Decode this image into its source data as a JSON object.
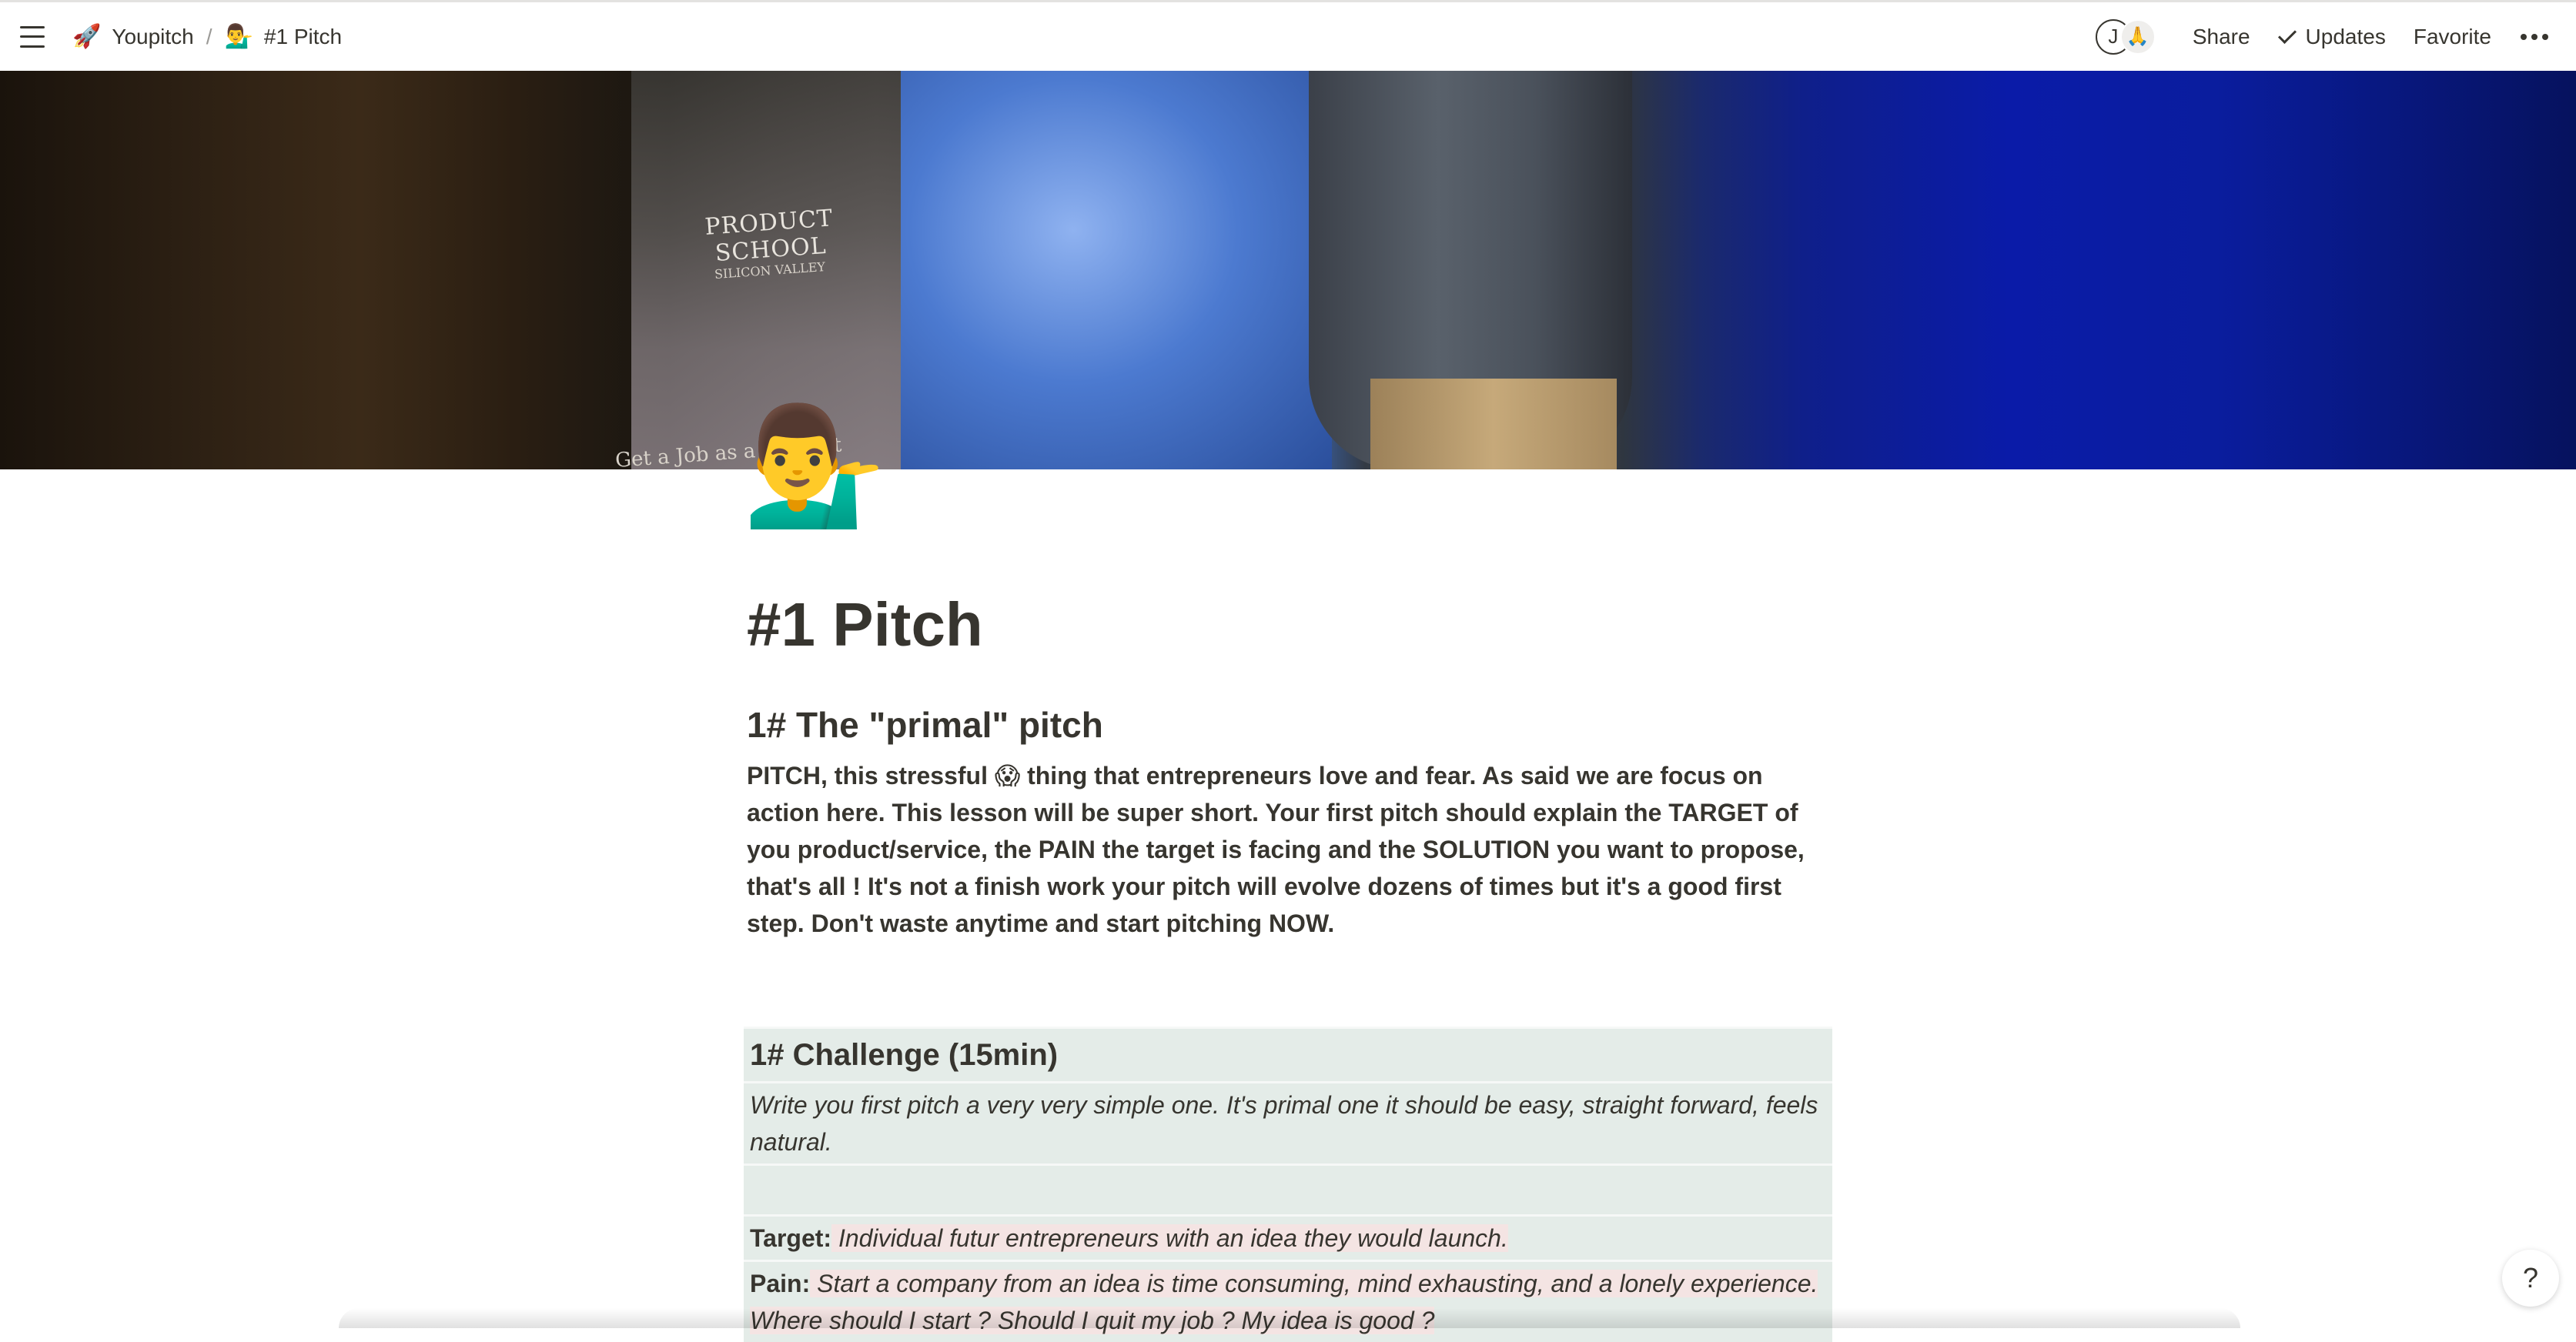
{
  "breadcrumb": [
    {
      "emoji": "🚀",
      "label": "Youpitch"
    },
    {
      "emoji": "💁‍♂️",
      "label": "#1 Pitch"
    }
  ],
  "breadcrumb_separator": "/",
  "topbar": {
    "avatar_initial": "J",
    "avatar_second": "🙏",
    "share_label": "Share",
    "updates_label": "Updates",
    "favorite_label": "Favorite"
  },
  "cover": {
    "banner_title": "PRODUCT SCHOOL",
    "banner_sub": "SILICON VALLEY",
    "banner_bottom": "Get a Job as a Product Manager"
  },
  "page": {
    "icon": "💁‍♂️",
    "title": "#1 Pitch",
    "section_heading": "1#  The \"primal\" pitch",
    "intro_before_emoji": "PITCH, this stressful ",
    "intro_emoji": "😱",
    "intro_after_emoji": " thing that entrepreneurs love and fear. As said we are focus on action here. This lesson will be super short. Your first pitch should explain the TARGET of you product/service, the PAIN the target is facing and the SOLUTION you want to propose, that's all !  It's not a finish work your pitch will evolve dozens of times but it's a good first step. Don't waste anytime and start pitching NOW."
  },
  "challenge": {
    "heading": "1# Challenge (15min)",
    "instructions": "Write you first pitch a very very simple one. It's primal one it should be easy, straight forward, feels natural.",
    "target_label": "Target:",
    "target_text": " Individual futur entrepreneurs with an idea they would launch.",
    "pain_label": "Pain:",
    "pain_text": " Start a company from an idea is time consuming, mind exhausting, and a lonely experience. Where should I start ? Should I quit my job ? My idea is good ?"
  },
  "help_label": "?"
}
